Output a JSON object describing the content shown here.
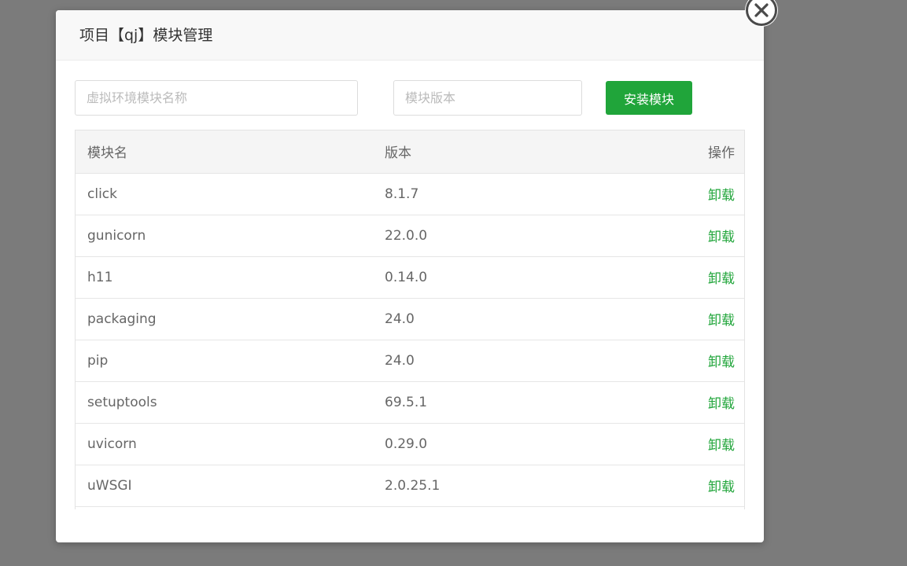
{
  "dialog": {
    "title": "项目【qj】模块管理"
  },
  "toolbar": {
    "name_placeholder": "虚拟环境模块名称",
    "version_placeholder": "模块版本",
    "install_label": "安装模块"
  },
  "table": {
    "headers": {
      "name": "模块名",
      "version": "版本",
      "action": "操作"
    },
    "rows": [
      {
        "name": "click",
        "version": "8.1.7",
        "action": "卸载"
      },
      {
        "name": "gunicorn",
        "version": "22.0.0",
        "action": "卸载"
      },
      {
        "name": "h11",
        "version": "0.14.0",
        "action": "卸载"
      },
      {
        "name": "packaging",
        "version": "24.0",
        "action": "卸载"
      },
      {
        "name": "pip",
        "version": "24.0",
        "action": "卸载"
      },
      {
        "name": "setuptools",
        "version": "69.5.1",
        "action": "卸载"
      },
      {
        "name": "uvicorn",
        "version": "0.29.0",
        "action": "卸载"
      },
      {
        "name": "uWSGI",
        "version": "2.0.25.1",
        "action": "卸载"
      }
    ]
  },
  "colors": {
    "accent": "#20a53a",
    "overlay": "#7b7b7b"
  },
  "icons": {
    "close": "close-circle-icon"
  }
}
